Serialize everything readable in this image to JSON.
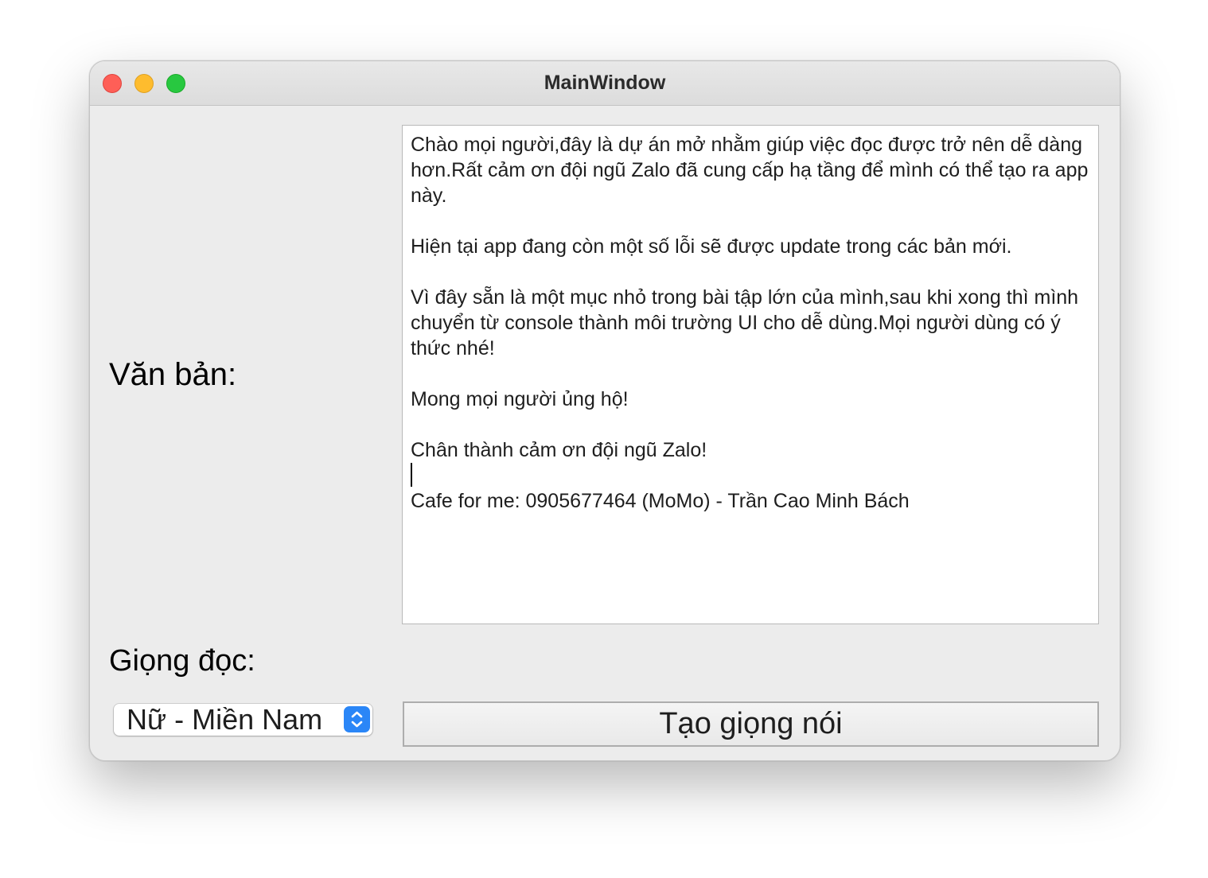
{
  "window": {
    "title": "MainWindow"
  },
  "labels": {
    "text_label": "Văn bản:",
    "voice_label": "Giọng đọc:"
  },
  "textbox": {
    "paragraphs": [
      "Chào mọi người,đây là dự án mở nhằm giúp việc đọc được trở nên dễ dàng hơn.Rất cảm ơn đội ngũ Zalo đã cung cấp hạ tầng để mình có thể tạo ra app này.",
      "Hiện tại app đang còn một số lỗi sẽ được update trong các bản mới.",
      "Vì đây sẵn là một mục nhỏ trong bài tập lớn của mình,sau khi xong thì mình chuyển từ console thành môi trường UI cho dễ dùng.Mọi người dùng có ý thức nhé!",
      "Mong mọi người ủng hộ!",
      "Chân thành cảm ơn đội ngũ Zalo!",
      "Cafe for me: 0905677464 (MoMo) - Trần Cao Minh Bách"
    ]
  },
  "voice_select": {
    "selected": "Nữ - Miền Nam"
  },
  "generate_button": {
    "label": "Tạo giọng nói"
  },
  "colors": {
    "window_bg": "#ececec",
    "close": "#fe5f57",
    "minimize": "#febc2e",
    "maximize": "#28c840",
    "select_accent": "#2a86f7"
  }
}
